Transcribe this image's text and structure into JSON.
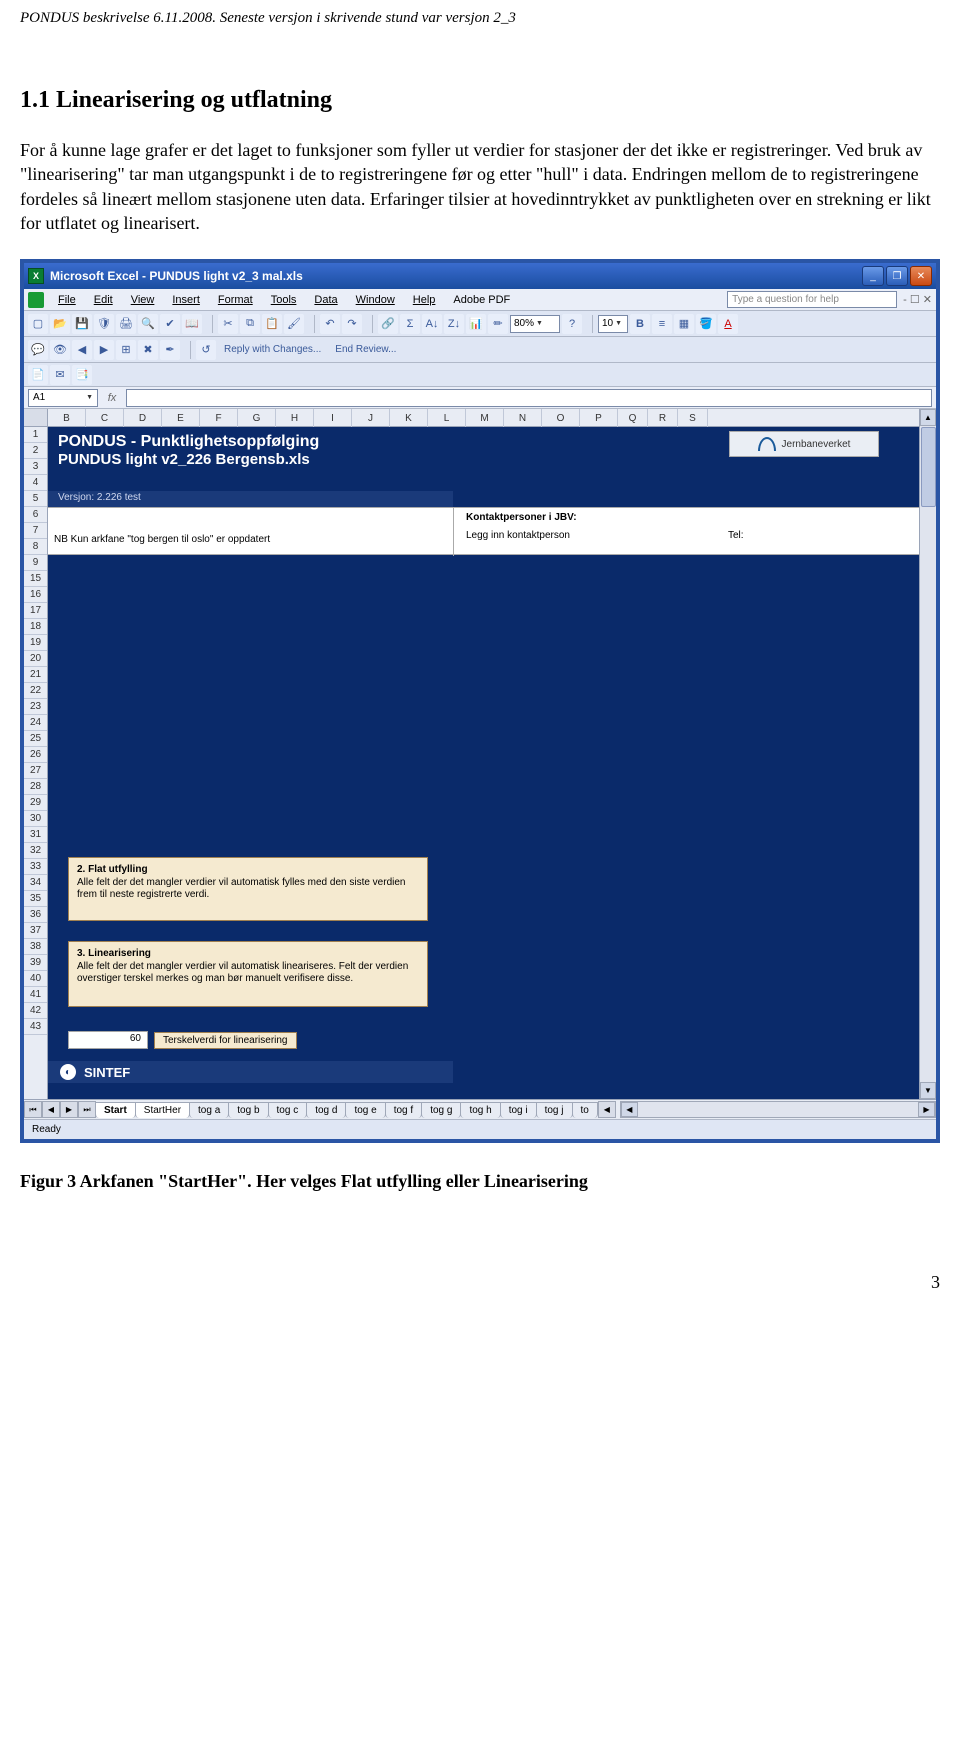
{
  "doc": {
    "header": "PONDUS beskrivelse 6.11.2008. Seneste versjon i skrivende stund var versjon 2_3",
    "section_title": "1.1 Linearisering og utflatning",
    "body": "For å kunne lage grafer er det laget to funksjoner som fyller ut verdier for stasjoner der det ikke er registreringer. Ved bruk av \"linearisering\" tar man utgangspunkt i de to registreringene før og etter \"hull\" i data. Endringen mellom de to registreringene fordeles så lineært mellom stasjonene uten data. Erfaringer tilsier at hovedinntrykket av punktligheten over en strekning er likt for utflatet og linearisert.",
    "figure_caption": "Figur 3 Arkfanen \"StartHer\". Her velges Flat utfylling eller Linearisering",
    "page_num": "3"
  },
  "titlebar": {
    "text": "Microsoft Excel - PUNDUS light v2_3 mal.xls",
    "min": "_",
    "max": "❐",
    "close": "✕"
  },
  "menu": {
    "file": "File",
    "edit": "Edit",
    "view": "View",
    "insert": "Insert",
    "format": "Format",
    "tools": "Tools",
    "data": "Data",
    "window": "Window",
    "help": "Help",
    "adobe": "Adobe PDF",
    "help_placeholder": "Type a question for help",
    "dash": "- ☐ ✕"
  },
  "toolbar": {
    "zoom": "80%",
    "font_size": "10",
    "reply": "Reply with Changes...",
    "end_review": "End Review..."
  },
  "formula": {
    "namebox": "A1"
  },
  "columns": [
    "B",
    "C",
    "D",
    "E",
    "F",
    "G",
    "H",
    "I",
    "J",
    "K",
    "L",
    "M",
    "N",
    "O",
    "P",
    "Q",
    "R",
    "S"
  ],
  "rows": [
    "1",
    "2",
    "3",
    "4",
    "5",
    "6",
    "7",
    "8",
    "9",
    "15",
    "16",
    "17",
    "18",
    "19",
    "20",
    "21",
    "22",
    "23",
    "24",
    "25",
    "26",
    "27",
    "28",
    "29",
    "30",
    "31",
    "32",
    "33",
    "34",
    "35",
    "36",
    "37",
    "38",
    "39",
    "40",
    "41",
    "42",
    "43"
  ],
  "sheet": {
    "title1": "PONDUS - Punktlighetsoppfølging",
    "title2": "PUNDUS light v2_226 Bergensb.xls",
    "version": "Versjon: 2.226 test",
    "note_left": "NB Kun arkfane \"tog bergen til oslo\" er oppdatert",
    "kontakt_header": "Kontaktpersoner i JBV:",
    "kontakt_value": "Legg inn kontaktperson",
    "tel": "Tel:",
    "logo": "Jernbaneverket",
    "box1_title": "2. Flat utfylling",
    "box1_text": "Alle felt der det mangler verdier vil automatisk fylles med den siste verdien frem til neste registrerte verdi.",
    "box2_title": "3. Linearisering",
    "box2_text": "Alle felt der det mangler verdier vil automatisk lineariseres. Felt der verdien overstiger terskel merkes og man bør manuelt verifisere disse.",
    "threshold_val": "60",
    "threshold_label": "Terskelverdi for linearisering",
    "sintef": "SINTEF"
  },
  "tabs": {
    "start": "Start",
    "items": [
      "StartHer",
      "tog a",
      "tog b",
      "tog c",
      "tog d",
      "tog e",
      "tog f",
      "tog g",
      "tog h",
      "tog i",
      "tog j",
      "to"
    ]
  },
  "status": {
    "ready": "Ready"
  }
}
